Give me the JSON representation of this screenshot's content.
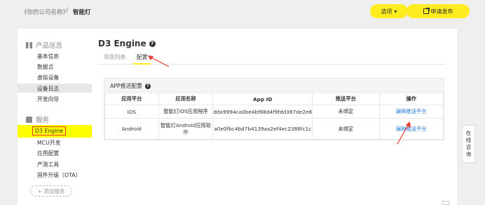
{
  "header": {
    "breadcrumb_company": "《你的公司名称》",
    "breadcrumb_separator": "/",
    "breadcrumb_product": "智能灯",
    "options_label": "选项",
    "options_chevron": "▾",
    "publish_label": "申请发布"
  },
  "sidebar": {
    "product_section": "产品信息",
    "product_items": [
      "基本信息",
      "数据点",
      "虚拟设备",
      "设备日志",
      "开发向导"
    ],
    "service_section": "服务",
    "service_items": [
      "D3 Engine",
      "MCU开发",
      "应用配置",
      "产测工具",
      "固件升级（OTA）"
    ],
    "add_service": "+ 添加服务"
  },
  "main": {
    "title": "D3 Engine",
    "tabs": [
      "项目列表",
      "配置"
    ],
    "config_title": "APP推送配置",
    "table": {
      "headers": [
        "应用平台",
        "应用名称",
        "App ID",
        "推送平台",
        "操作"
      ],
      "rows": [
        [
          "iOS",
          "智能灯iOS应用程序",
          "dda9994ca0be4bf88d4f9fdd387de2e8",
          "未绑定",
          "编辑推送平台"
        ],
        [
          "Android",
          "智能灯Android应用软件",
          "a0e0fbc4bd7b4139aa2ef4ec2388fc1c",
          "未绑定",
          "编辑推送平台"
        ]
      ]
    }
  },
  "chat": {
    "chars": [
      "在",
      "线",
      "咨",
      "询"
    ]
  },
  "colors": {
    "accent": "#ffec1f",
    "highlight": "#ffff00",
    "link": "#2b7bd6",
    "annotation": "#e63b2e"
  }
}
